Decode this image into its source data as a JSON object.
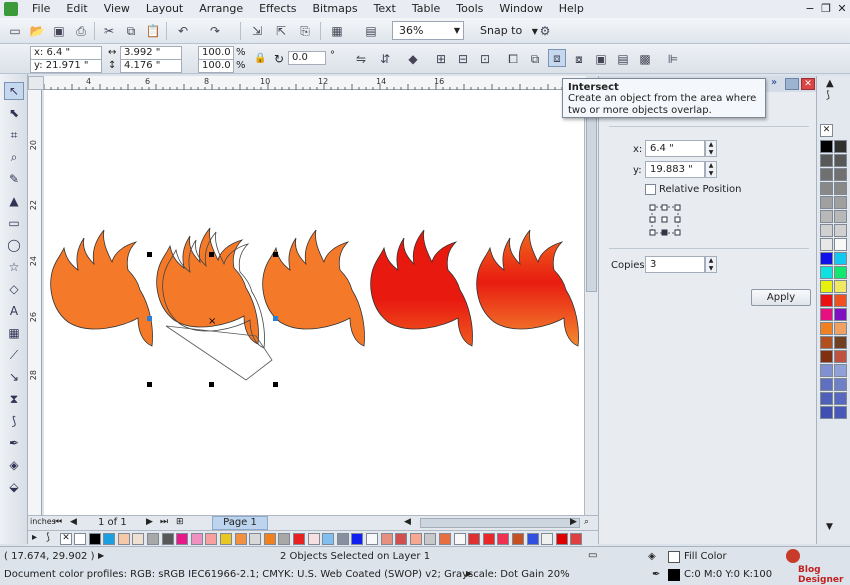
{
  "menu": [
    "File",
    "Edit",
    "View",
    "Layout",
    "Arrange",
    "Effects",
    "Bitmaps",
    "Text",
    "Table",
    "Tools",
    "Window",
    "Help"
  ],
  "toolbar": {
    "zoom": "36%",
    "snap": "Snap to"
  },
  "props": {
    "x": "x: 6.4 \"",
    "y": "y: 21.971 \"",
    "w": "3.992 \"",
    "h": "4.176 \"",
    "sx": "100.0",
    "sy": "100.0",
    "pct": "%",
    "rot": "0.0",
    "deg": "°"
  },
  "ruler_top": [
    "4",
    "6",
    "8",
    "10",
    "12",
    "14",
    "16"
  ],
  "ruler_left": [
    "20",
    "22",
    "24",
    "26",
    "28"
  ],
  "tooltip": {
    "title": "Intersect",
    "text": "Create an object from the area where two or more objects overlap."
  },
  "docker": {
    "x_label": "x:",
    "x_value": "6.4 \"",
    "y_label": "y:",
    "y_value": "19.883 \"",
    "relative_label": "Relative Position",
    "copies_label": "Copies:",
    "copies_value": "3",
    "apply": "Apply"
  },
  "pagenav": {
    "count": "1 of 1",
    "tab": "Page 1",
    "units": "inches"
  },
  "status": {
    "coords": "( 17.674, 29.902 )",
    "selection": "2 Objects Selected on Layer 1",
    "profiles": "Document color profiles: RGB: sRGB IEC61966-2.1; CMYK: U.S. Web Coated (SWOP) v2; Grayscale: Dot Gain 20%",
    "fill": "Fill Color",
    "cmyk": "C:0 M:0 Y:0 K:100",
    "brand": "Blog Designer"
  },
  "colors": {
    "orange": "#f47a2a",
    "red": "#e8180c",
    "outline": "#333333"
  },
  "h_palette": [
    "#ffffff",
    "#000000",
    "#1aa0e0",
    "#f6c8a8",
    "#f0e0d0",
    "#a8a8a8",
    "#585858",
    "#e81888",
    "#f090c0",
    "#f8a0a0",
    "#e8c820",
    "#f09040",
    "#d8d8d8",
    "#f08020",
    "#a8a8a8",
    "#e82020",
    "#f8e0e0",
    "#80c0f0",
    "#8890a0",
    "#1020f0",
    "#f8f8f8",
    "#e89080",
    "#d05050",
    "#f8a890",
    "#c8c8c8",
    "#e87040",
    "#f8f8f8",
    "#e03030",
    "#e82828",
    "#f03050",
    "#c85020",
    "#3050e0",
    "#f0f0f0",
    "#e00000",
    "#e04040"
  ],
  "v_palette": [
    [
      "#000000",
      "#303030"
    ],
    [
      "#585858",
      "#585858"
    ],
    [
      "#707070",
      "#707070"
    ],
    [
      "#888888",
      "#888888"
    ],
    [
      "#a0a0a0",
      "#a0a0a0"
    ],
    [
      "#b8b8b8",
      "#b8b8b8"
    ],
    [
      "#d0d0d0",
      "#d0d0d0"
    ],
    [
      "#e8e8e8",
      "#f8f8f8"
    ],
    [
      "#1010e8",
      "#10c8f0"
    ],
    [
      "#10e0e0",
      "#10e870"
    ],
    [
      "#e8f010",
      "#f0e860"
    ],
    [
      "#e81010",
      "#f05020"
    ],
    [
      "#e81080",
      "#8010c0"
    ],
    [
      "#f08020",
      "#f0a060"
    ],
    [
      "#b05020",
      "#704020"
    ],
    [
      "#803010",
      "#c05040"
    ],
    [
      "#8090d0",
      "#90a0d8"
    ],
    [
      "#6070c0",
      "#7080c8"
    ],
    [
      "#5060b8",
      "#5868c0"
    ],
    [
      "#4050b0",
      "#4858b8"
    ]
  ]
}
